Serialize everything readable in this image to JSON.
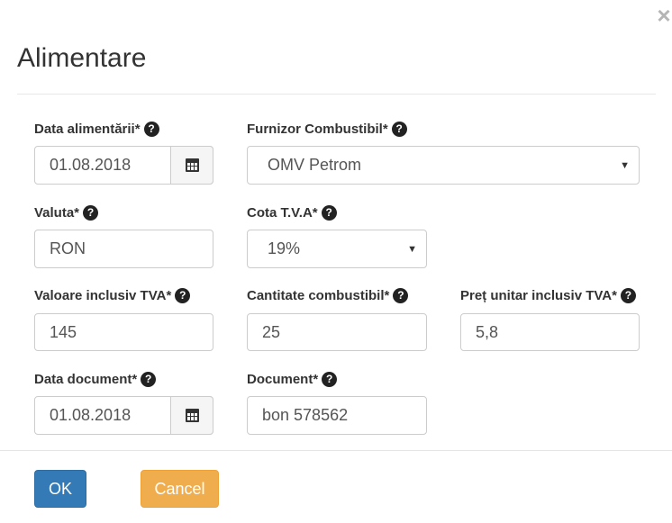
{
  "dialog": {
    "title": "Alimentare",
    "close_icon": "×"
  },
  "form": {
    "fuel_date": {
      "label": "Data alimentării*",
      "value": "01.08.2018",
      "icon": "calendar-icon"
    },
    "supplier": {
      "label": "Furnizor Combustibil*",
      "value": "OMV Petrom"
    },
    "currency": {
      "label": "Valuta*",
      "value": "RON"
    },
    "vat_rate": {
      "label": "Cota T.V.A*",
      "value": "19%"
    },
    "value_incl_vat": {
      "label": "Valoare inclusiv TVA*",
      "value": "145"
    },
    "fuel_quantity": {
      "label": "Cantitate combustibil*",
      "value": "25"
    },
    "unit_price": {
      "label": "Preț unitar inclusiv TVA*",
      "value": "5,8"
    },
    "document_date": {
      "label": "Data document*",
      "value": "01.08.2018",
      "icon": "calendar-icon"
    },
    "document": {
      "label": "Document*",
      "value": "bon 578562"
    },
    "help_glyph": "?",
    "caret_glyph": "▼"
  },
  "footer": {
    "ok_label": "OK",
    "cancel_label": "Cancel"
  },
  "colors": {
    "primary": "#337ab7",
    "warning": "#f0ad4e"
  }
}
